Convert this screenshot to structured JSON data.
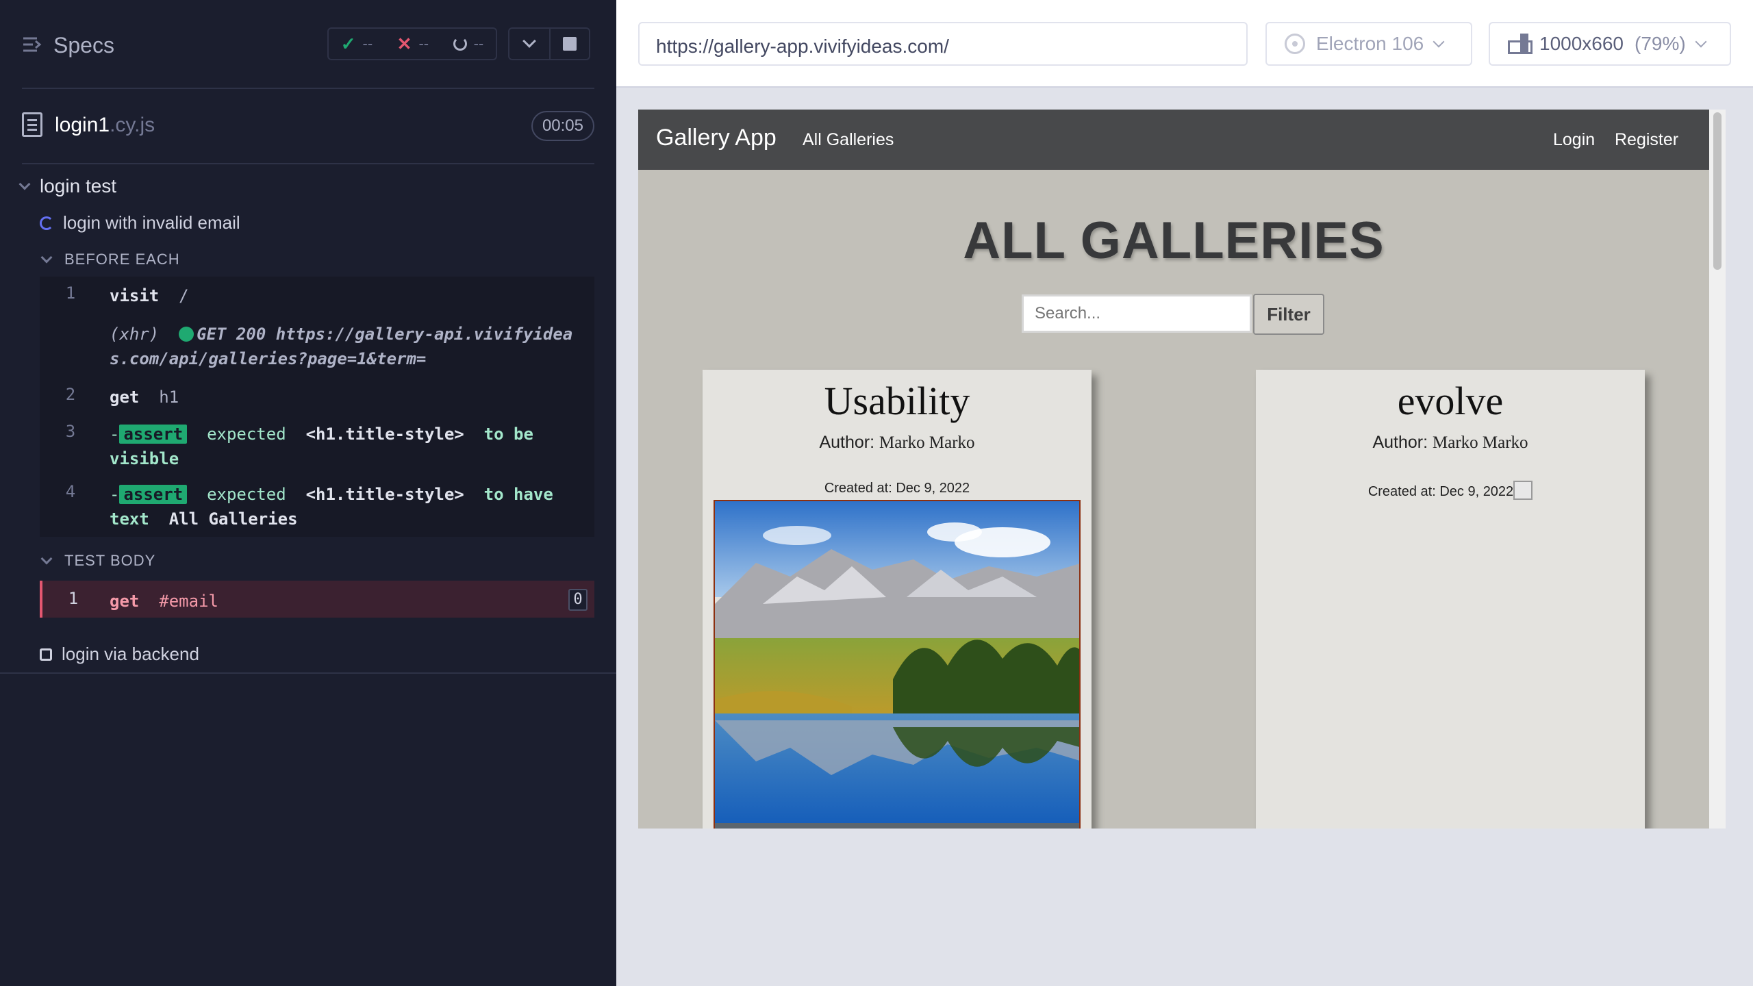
{
  "reporter": {
    "title": "Specs",
    "stats": {
      "passed": "--",
      "failed": "--",
      "pending": "--"
    },
    "spec": {
      "name": "login1",
      "ext": ".cy.js",
      "duration": "00:05"
    },
    "suite": "login test",
    "tests": [
      "login with invalid email",
      "login via backend"
    ],
    "hooks": {
      "before_each": "BEFORE EACH",
      "test_body": "TEST BODY"
    },
    "before_each_commands": [
      {
        "num": "1",
        "name": "visit",
        "msg": "/"
      },
      {
        "xhr": "(xhr)",
        "request": "GET 200 https://gallery-api.vivifyideas.com/api/galleries?page=1&term="
      },
      {
        "num": "2",
        "name": "get",
        "msg": "h1"
      },
      {
        "num": "3",
        "prefix": "-",
        "tag": "assert",
        "msg1": "expected",
        "selector": "<h1.title-style>",
        "msg2": "to be visible"
      },
      {
        "num": "4",
        "prefix": "-",
        "tag": "assert",
        "msg1": "expected",
        "selector": "<h1.title-style>",
        "msg2": "to have text",
        "text": "All Galleries"
      }
    ],
    "test_body_commands": [
      {
        "num": "1",
        "name": "get",
        "msg": "#email",
        "count": "0"
      }
    ]
  },
  "toolbar": {
    "url": "https://gallery-app.vivifyideas.com/",
    "browser": "Electron 106",
    "viewport": "1000x660",
    "scale": "(79%)"
  },
  "app": {
    "brand": "Gallery App",
    "nav_all": "All Galleries",
    "nav_login": "Login",
    "nav_register": "Register",
    "heading": "ALL GALLERIES",
    "search_placeholder": "Search...",
    "filter": "Filter",
    "author_label": "Author:",
    "created_label": "Created at:",
    "galleries": [
      {
        "title": "Usability",
        "author": "Marko Marko",
        "created": "Dec 9, 2022"
      },
      {
        "title": "evolve",
        "author": "Marko Marko",
        "created": "Dec 9, 2022"
      }
    ]
  },
  "colors": {
    "pass": "#1fa971",
    "fail": "#e45770",
    "running": "#6470f3",
    "reporter_bg": "#1b1e2e"
  }
}
